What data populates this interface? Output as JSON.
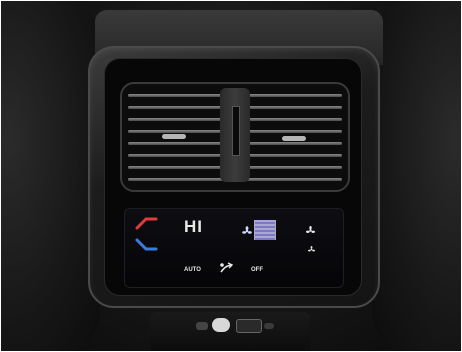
{
  "panel": {
    "temperature_level": "HI",
    "auto_label": "AUTO",
    "off_label": "OFF",
    "fan_level_bars": 5
  },
  "colors": {
    "warm_accent": "#e23a3a",
    "cool_accent": "#3a7be2",
    "text": "#e8e8e8"
  },
  "icons": [
    "temp-up-icon",
    "temp-down-icon",
    "fan-icon",
    "fan-speed-up-icon",
    "fan-speed-down-icon",
    "airflow-icon"
  ]
}
